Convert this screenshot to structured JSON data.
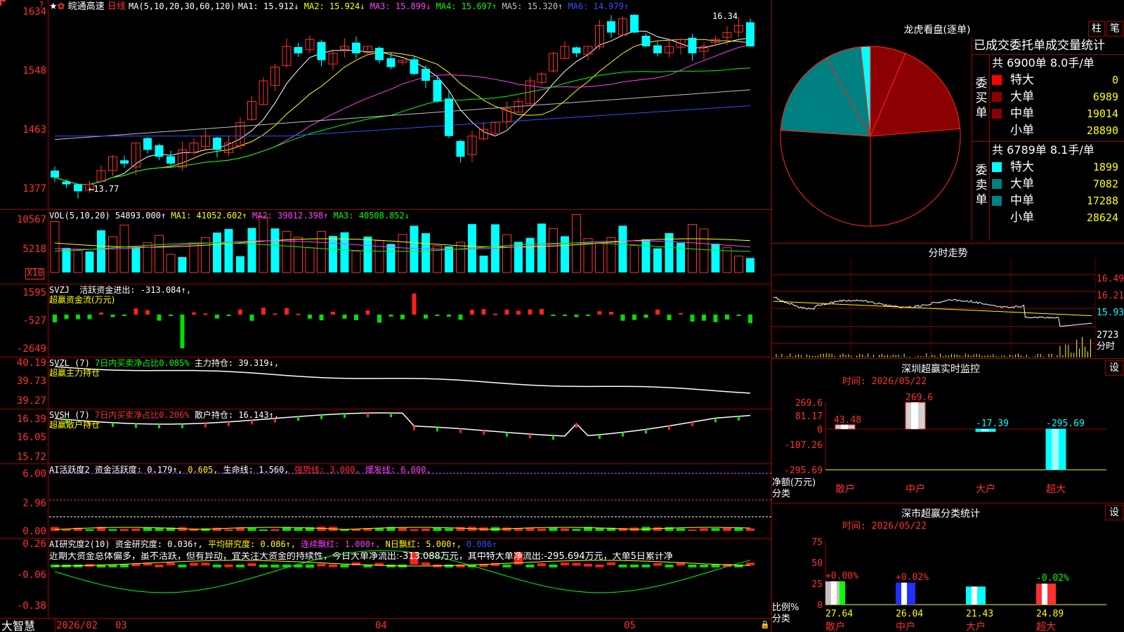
{
  "header": {
    "stock_name": "皖通高速",
    "period": "日线",
    "ma_label": "MA(5,10,20,30,60,120)",
    "ma": [
      {
        "label": "MA1:",
        "value": "15.912↓",
        "color": "#ffffff"
      },
      {
        "label": "MA2:",
        "value": "15.924↓",
        "color": "#ffff00"
      },
      {
        "label": "MA3:",
        "value": "15.899↓",
        "color": "#ff40ff"
      },
      {
        "label": "MA4:",
        "value": "15.697↑",
        "color": "#00ff00"
      },
      {
        "label": "MA5:",
        "value": "15.320↑",
        "color": "#c0c0c0"
      },
      {
        "label": "MA6:",
        "value": "14.979↑",
        "color": "#3050ff"
      }
    ],
    "high_annot": "16.34",
    "low_annot": "←13.77"
  },
  "price_axis": [
    "1634",
    "1548",
    "1463",
    "1377"
  ],
  "vol": {
    "title": "VOL(5,10,20)",
    "value": "54893.000↑",
    "ma": [
      {
        "label": "MA1:",
        "value": "41052.602↑",
        "color": "#ffff00"
      },
      {
        "label": "MA2:",
        "value": "39012.398↑",
        "color": "#ff40ff"
      },
      {
        "label": "MA3:",
        "value": "40508.852↓",
        "color": "#00ff00"
      }
    ],
    "axis": [
      "10567",
      "5218"
    ],
    "unit": "X10"
  },
  "svzj": {
    "title": "SVZJ",
    "label": "活跃资金进出:",
    "value": "-313.084↑,",
    "sub": "超赢资金流(万元)",
    "axis": [
      "1595",
      "-527",
      "-2649"
    ]
  },
  "svzl": {
    "title": "SVZL (7)",
    "label1": "7日内买卖净占比0.085%",
    "label2": "主力持仓:",
    "value": "39.319↓,",
    "sub": "超赢主力持仓",
    "axis": [
      "40.19",
      "39.73",
      "39.27"
    ]
  },
  "svsh": {
    "title": "SVSH (7)",
    "label1": "7日内买卖净占比0.206%",
    "label2": "散户持仓:",
    "value": "16.143↑,",
    "sub": "超赢散户持仓",
    "axis": [
      "16.39",
      "16.05",
      "15.72"
    ]
  },
  "ai2": {
    "title": "AI活跃度2",
    "label": "资金活跃度:",
    "v1": "0.179↑,",
    "v2": "0.605,",
    "life": "生命线: 1.560,",
    "strong": "强势线: 3.000,",
    "burst": "爆发线: 6.000,",
    "axis": [
      "6.00",
      "2.96",
      "0.00"
    ]
  },
  "ai3": {
    "title": "AI研究度2(10)",
    "label": "资金研究度:",
    "v1": "0.036↑,",
    "avg": "平均研究度: 0.086↑,",
    "cont": "连续飘红: 1.000↑,",
    "ndays": "N日飘红: 5.000↑,",
    "last": "0.086↑",
    "comment": "近期大资金总体偏多，虽不活跃，但有异动，宜关注大资金的持续性，今日大单净流出:-313.088万元，其中特大单净流出:-295.694万元，大单5日累计净",
    "axis": [
      "0.26",
      "-0.06",
      "-0.38"
    ]
  },
  "footer": {
    "brand": "大智慧",
    "dates": [
      "2026/02",
      "03",
      "04",
      "05"
    ]
  },
  "lh": {
    "title": "龙虎看盘(逐单)",
    "btn1": "柱",
    "btn2": "笔",
    "table_title": "已成交委托单成交量统计",
    "buy": {
      "side": "委买单",
      "summary": "共 6900单 8.0手/单",
      "rows": [
        {
          "name": "特大",
          "vol": "0",
          "pct": "0%",
          "color": "#ff0000"
        },
        {
          "name": "大单",
          "vol": "6989",
          "pct": "13%",
          "color": "#8b0000"
        },
        {
          "name": "中单",
          "vol": "19014",
          "pct": "35%",
          "color": "#8b0000"
        },
        {
          "name": "小单",
          "vol": "28890",
          "pct": "53%",
          "color": "#000000"
        }
      ]
    },
    "sell": {
      "side": "委卖单",
      "summary": "共 6789单 8.1手/单",
      "rows": [
        {
          "name": "特大",
          "vol": "1899",
          "pct": "3%",
          "color": "#00ffff"
        },
        {
          "name": "大单",
          "vol": "7082",
          "pct": "13%",
          "color": "#008080"
        },
        {
          "name": "中单",
          "vol": "17288",
          "pct": "31%",
          "color": "#008080"
        },
        {
          "name": "小单",
          "vol": "28624",
          "pct": "52%",
          "color": "#000000"
        }
      ]
    }
  },
  "fs": {
    "title": "分时走势",
    "axis": [
      "16.49",
      "16.21",
      "15.93",
      "2723"
    ],
    "unit": "分时"
  },
  "sz": {
    "title": "深圳超赢实时监控",
    "btn": "设",
    "time": "时间: 2026/05/22",
    "ylabel": "净额(万元)",
    "xlabel": "分类"
  },
  "sc": {
    "title": "深市超赢分类统计",
    "btn": "设",
    "time": "时间: 2026/05/22",
    "ylabel": "比例%",
    "xlabel": "分类"
  },
  "chart_data": [
    {
      "type": "pie",
      "categories": [
        "买特大",
        "买大单",
        "买中单",
        "买小单",
        "卖小单",
        "卖中单",
        "卖大单",
        "卖特大"
      ],
      "values": [
        0,
        6989,
        19014,
        28890,
        28624,
        17288,
        7082,
        1899
      ],
      "colors": [
        "#ff0000",
        "#8b0000",
        "#8b0000",
        "#000000",
        "#000000",
        "#008080",
        "#008080",
        "#00ffff"
      ]
    },
    {
      "type": "bar",
      "categories": [
        "散户",
        "中户",
        "大户",
        "超大"
      ],
      "values": [
        43.48,
        269.6,
        -17.39,
        -295.69
      ],
      "value_labels": [
        "43.48",
        "269.6",
        "-17.39",
        "-295.69"
      ],
      "axis_labels": [
        "269.6",
        "81.17",
        "0",
        "-107.26",
        "-295.69"
      ],
      "ylim": [
        -295.69,
        269.6
      ]
    },
    {
      "type": "bar",
      "categories": [
        "散户",
        "中户",
        "大户",
        "超大"
      ],
      "values": [
        27.64,
        26.04,
        21.43,
        24.89
      ],
      "value_labels": [
        "27.64",
        "26.04",
        "21.43",
        "24.89"
      ],
      "change_labels": [
        "+0.00%",
        "+0.02%",
        "",
        "-0.02%"
      ],
      "axis_labels": [
        "75",
        "50",
        "25",
        "0"
      ],
      "ylim": [
        0,
        75
      ]
    }
  ]
}
